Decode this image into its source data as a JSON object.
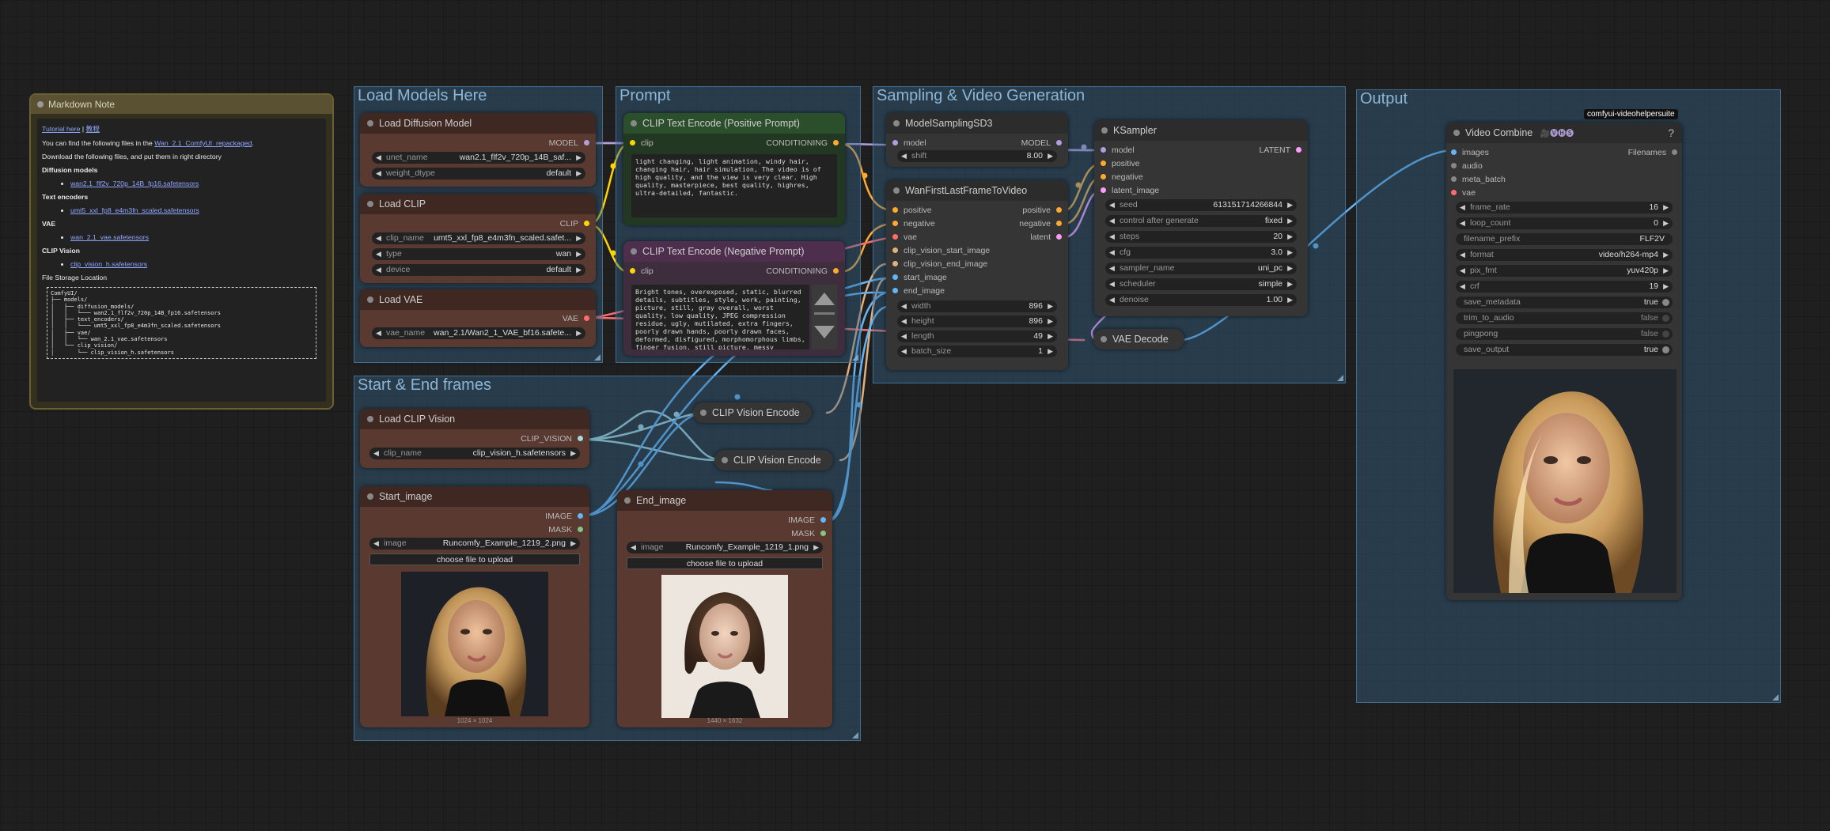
{
  "groups": {
    "load_models": "Load Models Here",
    "prompt": "Prompt",
    "sampling": "Sampling & Video Generation",
    "output": "Output",
    "start_end": "Start & End frames"
  },
  "markdown_note": {
    "title": "Markdown Note",
    "tutorial_link": "Tutorial here",
    "tutorial_link_cn": "教程",
    "line1_pre": "You can find the following files in the ",
    "line1_link": "Wan_2.1_ComfyUI_repackaged",
    "line1_post": ".",
    "line2": "Download the following files, and put them in right directory",
    "diffusion_heading": "Diffusion models",
    "diffusion_file": "wan2.1_flf2v_720p_14B_fp16.safetensors",
    "text_enc_heading": "Text encoders",
    "text_enc_file": "umt5_xxl_fp8_e4m3fn_scaled.safetensors",
    "vae_heading": "VAE",
    "vae_file": "wan_2.1_vae.safetensors",
    "clip_vision_heading": "CLIP Vision",
    "clip_vision_file": "clip_vision_h.safetensors",
    "storage_heading": "File Storage Location",
    "tree": "ComfyUI/\n├── models/\n│   ├── diffusion_models/\n│   │   └─── wan2.1_flf2v_720p_14B_fp16.safetensors\n│   ├── text_encoders/\n│   │   └─── umt5_xxl_fp8_e4m3fn_scaled.safetensors\n│   ├── vae/\n│   │   └── wan_2.1_vae.safetensors\n│   └── clip_vision/\n│       └── clip_vision_h.safetensors"
  },
  "load_diffusion": {
    "title": "Load Diffusion Model",
    "out": "MODEL",
    "unet_label": "unet_name",
    "unet_value": "wan2.1_flf2v_720p_14B_saf...",
    "dtype_label": "weight_dtype",
    "dtype_value": "default"
  },
  "load_clip": {
    "title": "Load CLIP",
    "out": "CLIP",
    "clip_label": "clip_name",
    "clip_value": "umt5_xxl_fp8_e4m3fn_scaled.safet...",
    "type_label": "type",
    "type_value": "wan",
    "device_label": "device",
    "device_value": "default"
  },
  "load_vae": {
    "title": "Load VAE",
    "out": "VAE",
    "vae_label": "vae_name",
    "vae_value": "wan_2.1/Wan2_1_VAE_bf16.safete..."
  },
  "clip_pos": {
    "title": "CLIP Text Encode (Positive Prompt)",
    "in": "clip",
    "out": "CONDITIONING",
    "text": "light changing, light animation, windy hair, changing hair, hair simulation, The video is of high quality, and the view is very clear. High quality, masterpiece, best quality, highres, ultra-detailed, fantastic."
  },
  "clip_neg": {
    "title": "CLIP Text Encode (Negative Prompt)",
    "in": "clip",
    "out": "CONDITIONING",
    "text": "Bright tones, overexposed, static, blurred details, subtitles, style, work, painting, picture, still, gray overall, worst quality, low quality, JPEG compression residue, ugly, mutilated, extra fingers, poorly drawn hands, poorly drawn faces, deformed, disfigured, morphomorphous limbs, finger fusion, still picture, messy background, three legs, a lot of people in the background, walking backwards"
  },
  "model_sampling": {
    "title": "ModelSamplingSD3",
    "in": "model",
    "out": "MODEL",
    "shift_label": "shift",
    "shift_value": "8.00"
  },
  "wan_flf": {
    "title": "WanFirstLastFrameToVideo",
    "inputs": [
      "positive",
      "negative",
      "vae",
      "clip_vision_start_image",
      "clip_vision_end_image",
      "start_image",
      "end_image"
    ],
    "outputs": [
      "positive",
      "negative",
      "latent"
    ],
    "width_label": "width",
    "width_value": "896",
    "height_label": "height",
    "height_value": "896",
    "length_label": "length",
    "length_value": "49",
    "batch_label": "batch_size",
    "batch_value": "1"
  },
  "ksampler": {
    "title": "KSampler",
    "inputs": [
      "model",
      "positive",
      "negative",
      "latent_image"
    ],
    "out": "LATENT",
    "widgets": [
      {
        "label": "seed",
        "value": "613151714266844"
      },
      {
        "label": "control after generate",
        "value": "fixed"
      },
      {
        "label": "steps",
        "value": "20"
      },
      {
        "label": "cfg",
        "value": "3.0"
      },
      {
        "label": "sampler_name",
        "value": "uni_pc"
      },
      {
        "label": "scheduler",
        "value": "simple"
      },
      {
        "label": "denoise",
        "value": "1.00"
      }
    ]
  },
  "vae_decode": {
    "title": "VAE Decode"
  },
  "video_combine": {
    "title": "Video Combine",
    "tag": "comfyui-videohelpersuite",
    "help": "?",
    "inputs": [
      "images",
      "audio",
      "meta_batch",
      "vae"
    ],
    "out": "Filenames",
    "widgets": [
      {
        "label": "frame_rate",
        "value": "16"
      },
      {
        "label": "loop_count",
        "value": "0"
      },
      {
        "label": "filename_prefix",
        "value": "FLF2V"
      },
      {
        "label": "format",
        "value": "video/h264-mp4"
      },
      {
        "label": "pix_fmt",
        "value": "yuv420p"
      },
      {
        "label": "crf",
        "value": "19"
      }
    ],
    "toggles": [
      {
        "label": "save_metadata",
        "value": "true",
        "on": true
      },
      {
        "label": "trim_to_audio",
        "value": "false",
        "on": false
      },
      {
        "label": "pingpong",
        "value": "false",
        "on": false
      },
      {
        "label": "save_output",
        "value": "true",
        "on": true
      }
    ]
  },
  "load_clip_vision": {
    "title": "Load CLIP Vision",
    "out": "CLIP_VISION",
    "clip_label": "clip_name",
    "clip_value": "clip_vision_h.safetensors"
  },
  "clip_vision_encode_1": {
    "title": "CLIP Vision Encode"
  },
  "clip_vision_encode_2": {
    "title": "CLIP Vision Encode"
  },
  "start_image": {
    "title": "Start_image",
    "outs": [
      "IMAGE",
      "MASK"
    ],
    "image_label": "image",
    "image_value": "Runcomfy_Example_1219_2.png",
    "upload": "choose file to upload",
    "caption": "1024 × 1024"
  },
  "end_image": {
    "title": "End_image",
    "outs": [
      "IMAGE",
      "MASK"
    ],
    "image_label": "image",
    "image_value": "Runcomfy_Example_1219_1.png",
    "upload": "choose file to upload",
    "caption": "1440 × 1632"
  },
  "colors": {
    "model": "#b39ddb",
    "clip": "#ffd500",
    "vae": "#ff6e6e",
    "conditioning": "#ffa931",
    "latent": "#ff9cf9",
    "image": "#64b5f6",
    "clip_vision": "#a8dadc",
    "mask": "#81c784"
  }
}
